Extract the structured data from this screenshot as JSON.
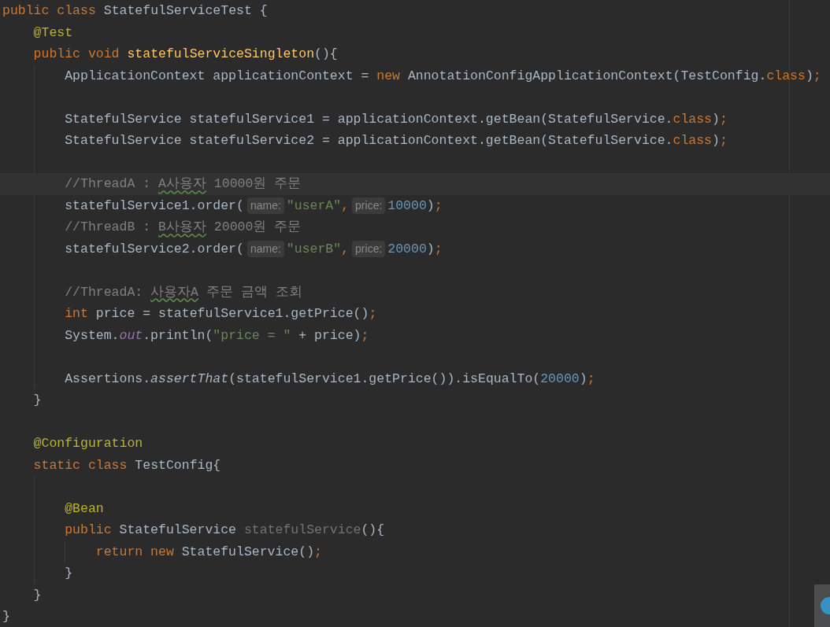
{
  "editor": {
    "lines": [
      {
        "kind": "code",
        "current": false,
        "tokens": [
          {
            "kind": "keyword",
            "text": "public class "
          },
          {
            "kind": "plain",
            "text": "StatefulServiceTest {"
          }
        ],
        "children": [
          {
            "kind": "code",
            "current": false,
            "tokens": [
              {
                "kind": "annotation",
                "text": "@Test"
              }
            ]
          },
          {
            "kind": "code",
            "current": false,
            "tokens": [
              {
                "kind": "keyword",
                "text": "public void "
              },
              {
                "kind": "declaration",
                "text": "statefulServiceSingleton"
              },
              {
                "kind": "plain",
                "text": "(){"
              }
            ],
            "children": [
              {
                "kind": "code",
                "current": false,
                "tokens": [
                  {
                    "kind": "plain",
                    "text": "ApplicationContext applicationContext = "
                  },
                  {
                    "kind": "keyword",
                    "text": "new"
                  },
                  {
                    "kind": "plain",
                    "text": " AnnotationConfigApplicationContext(TestConfig."
                  },
                  {
                    "kind": "keyword",
                    "text": "class"
                  },
                  {
                    "kind": "plain",
                    "text": ")"
                  },
                  {
                    "kind": "keyword",
                    "text": ";"
                  }
                ]
              },
              {
                "kind": "blank"
              },
              {
                "kind": "code",
                "current": false,
                "tokens": [
                  {
                    "kind": "plain",
                    "text": "StatefulService statefulService1 = applicationContext.getBean(StatefulService."
                  },
                  {
                    "kind": "keyword",
                    "text": "class"
                  },
                  {
                    "kind": "plain",
                    "text": ")"
                  },
                  {
                    "kind": "keyword",
                    "text": ";"
                  }
                ]
              },
              {
                "kind": "code",
                "current": false,
                "tokens": [
                  {
                    "kind": "plain",
                    "text": "StatefulService statefulService2 = applicationContext.getBean(StatefulService."
                  },
                  {
                    "kind": "keyword",
                    "text": "class"
                  },
                  {
                    "kind": "plain",
                    "text": ")"
                  },
                  {
                    "kind": "keyword",
                    "text": ";"
                  }
                ]
              },
              {
                "kind": "blank"
              },
              {
                "kind": "code",
                "current": true,
                "tokens": [
                  {
                    "kind": "comment",
                    "text": "//ThreadA : "
                  },
                  {
                    "kind": "flagged",
                    "text": "A사용자"
                  },
                  {
                    "kind": "comment",
                    "text": " 10000원 주문"
                  }
                ]
              },
              {
                "kind": "code",
                "current": false,
                "tokens": [
                  {
                    "kind": "plain",
                    "text": "statefulService1.order("
                  },
                  {
                    "kind": "hint",
                    "text": "name:"
                  },
                  {
                    "kind": "string",
                    "text": "\"userA\""
                  },
                  {
                    "kind": "keyword",
                    "text": ","
                  },
                  {
                    "kind": "hint",
                    "text": "price:"
                  },
                  {
                    "kind": "number",
                    "text": "10000"
                  },
                  {
                    "kind": "plain",
                    "text": ")"
                  },
                  {
                    "kind": "keyword",
                    "text": ";"
                  }
                ]
              },
              {
                "kind": "code",
                "current": false,
                "tokens": [
                  {
                    "kind": "comment",
                    "text": "//ThreadB : "
                  },
                  {
                    "kind": "flagged",
                    "text": "B사용자"
                  },
                  {
                    "kind": "comment",
                    "text": " 20000원 주문"
                  }
                ]
              },
              {
                "kind": "code",
                "current": false,
                "tokens": [
                  {
                    "kind": "plain",
                    "text": "statefulService2.order("
                  },
                  {
                    "kind": "hint",
                    "text": "name:"
                  },
                  {
                    "kind": "string",
                    "text": "\"userB\""
                  },
                  {
                    "kind": "keyword",
                    "text": ","
                  },
                  {
                    "kind": "hint",
                    "text": "price:"
                  },
                  {
                    "kind": "number",
                    "text": "20000"
                  },
                  {
                    "kind": "plain",
                    "text": ")"
                  },
                  {
                    "kind": "keyword",
                    "text": ";"
                  }
                ]
              },
              {
                "kind": "blank"
              },
              {
                "kind": "code",
                "current": false,
                "tokens": [
                  {
                    "kind": "comment",
                    "text": "//ThreadA: "
                  },
                  {
                    "kind": "flagged",
                    "text": "사용자A"
                  },
                  {
                    "kind": "comment",
                    "text": " 주문 금액 조회"
                  }
                ]
              },
              {
                "kind": "code",
                "current": false,
                "tokens": [
                  {
                    "kind": "keyword",
                    "text": "int"
                  },
                  {
                    "kind": "plain",
                    "text": " price = statefulService1.getPrice()"
                  },
                  {
                    "kind": "keyword",
                    "text": ";"
                  }
                ]
              },
              {
                "kind": "code",
                "current": false,
                "tokens": [
                  {
                    "kind": "plain",
                    "text": "System."
                  },
                  {
                    "kind": "field",
                    "text": "out"
                  },
                  {
                    "kind": "plain",
                    "text": ".println("
                  },
                  {
                    "kind": "string",
                    "text": "\"price = \""
                  },
                  {
                    "kind": "plain",
                    "text": " + price)"
                  },
                  {
                    "kind": "keyword",
                    "text": ";"
                  }
                ]
              },
              {
                "kind": "blank"
              },
              {
                "kind": "code",
                "current": false,
                "tokens": [
                  {
                    "kind": "plain",
                    "text": "Assertions."
                  },
                  {
                    "kind": "static_call",
                    "text": "assertThat"
                  },
                  {
                    "kind": "plain",
                    "text": "(statefulService1.getPrice()).isEqualTo("
                  },
                  {
                    "kind": "number",
                    "text": "20000"
                  },
                  {
                    "kind": "plain",
                    "text": ")"
                  },
                  {
                    "kind": "keyword",
                    "text": ";"
                  }
                ]
              }
            ]
          },
          {
            "kind": "code",
            "current": false,
            "tokens": [
              {
                "kind": "plain",
                "text": "}"
              }
            ]
          },
          {
            "kind": "blank"
          },
          {
            "kind": "code",
            "current": false,
            "tokens": [
              {
                "kind": "annotation",
                "text": "@Configuration"
              }
            ]
          },
          {
            "kind": "code",
            "current": false,
            "tokens": [
              {
                "kind": "keyword",
                "text": "static class "
              },
              {
                "kind": "plain",
                "text": "TestConfig{"
              }
            ],
            "children": [
              {
                "kind": "blank"
              },
              {
                "kind": "code",
                "current": false,
                "tokens": [
                  {
                    "kind": "annotation",
                    "text": "@Bean"
                  }
                ]
              },
              {
                "kind": "code",
                "current": false,
                "tokens": [
                  {
                    "kind": "keyword",
                    "text": "public "
                  },
                  {
                    "kind": "plain",
                    "text": "StatefulService "
                  },
                  {
                    "kind": "unused",
                    "text": "statefulService"
                  },
                  {
                    "kind": "plain",
                    "text": "(){"
                  }
                ],
                "children": [
                  {
                    "kind": "code",
                    "current": false,
                    "tokens": [
                      {
                        "kind": "keyword",
                        "text": "return new "
                      },
                      {
                        "kind": "plain",
                        "text": "StatefulService()"
                      },
                      {
                        "kind": "keyword",
                        "text": ";"
                      }
                    ]
                  }
                ]
              },
              {
                "kind": "code",
                "current": false,
                "tokens": [
                  {
                    "kind": "plain",
                    "text": "}"
                  }
                ]
              }
            ]
          },
          {
            "kind": "code",
            "current": false,
            "tokens": [
              {
                "kind": "plain",
                "text": "}"
              }
            ]
          }
        ]
      },
      {
        "kind": "code",
        "current": false,
        "tokens": [
          {
            "kind": "plain",
            "text": "}"
          }
        ]
      }
    ]
  }
}
